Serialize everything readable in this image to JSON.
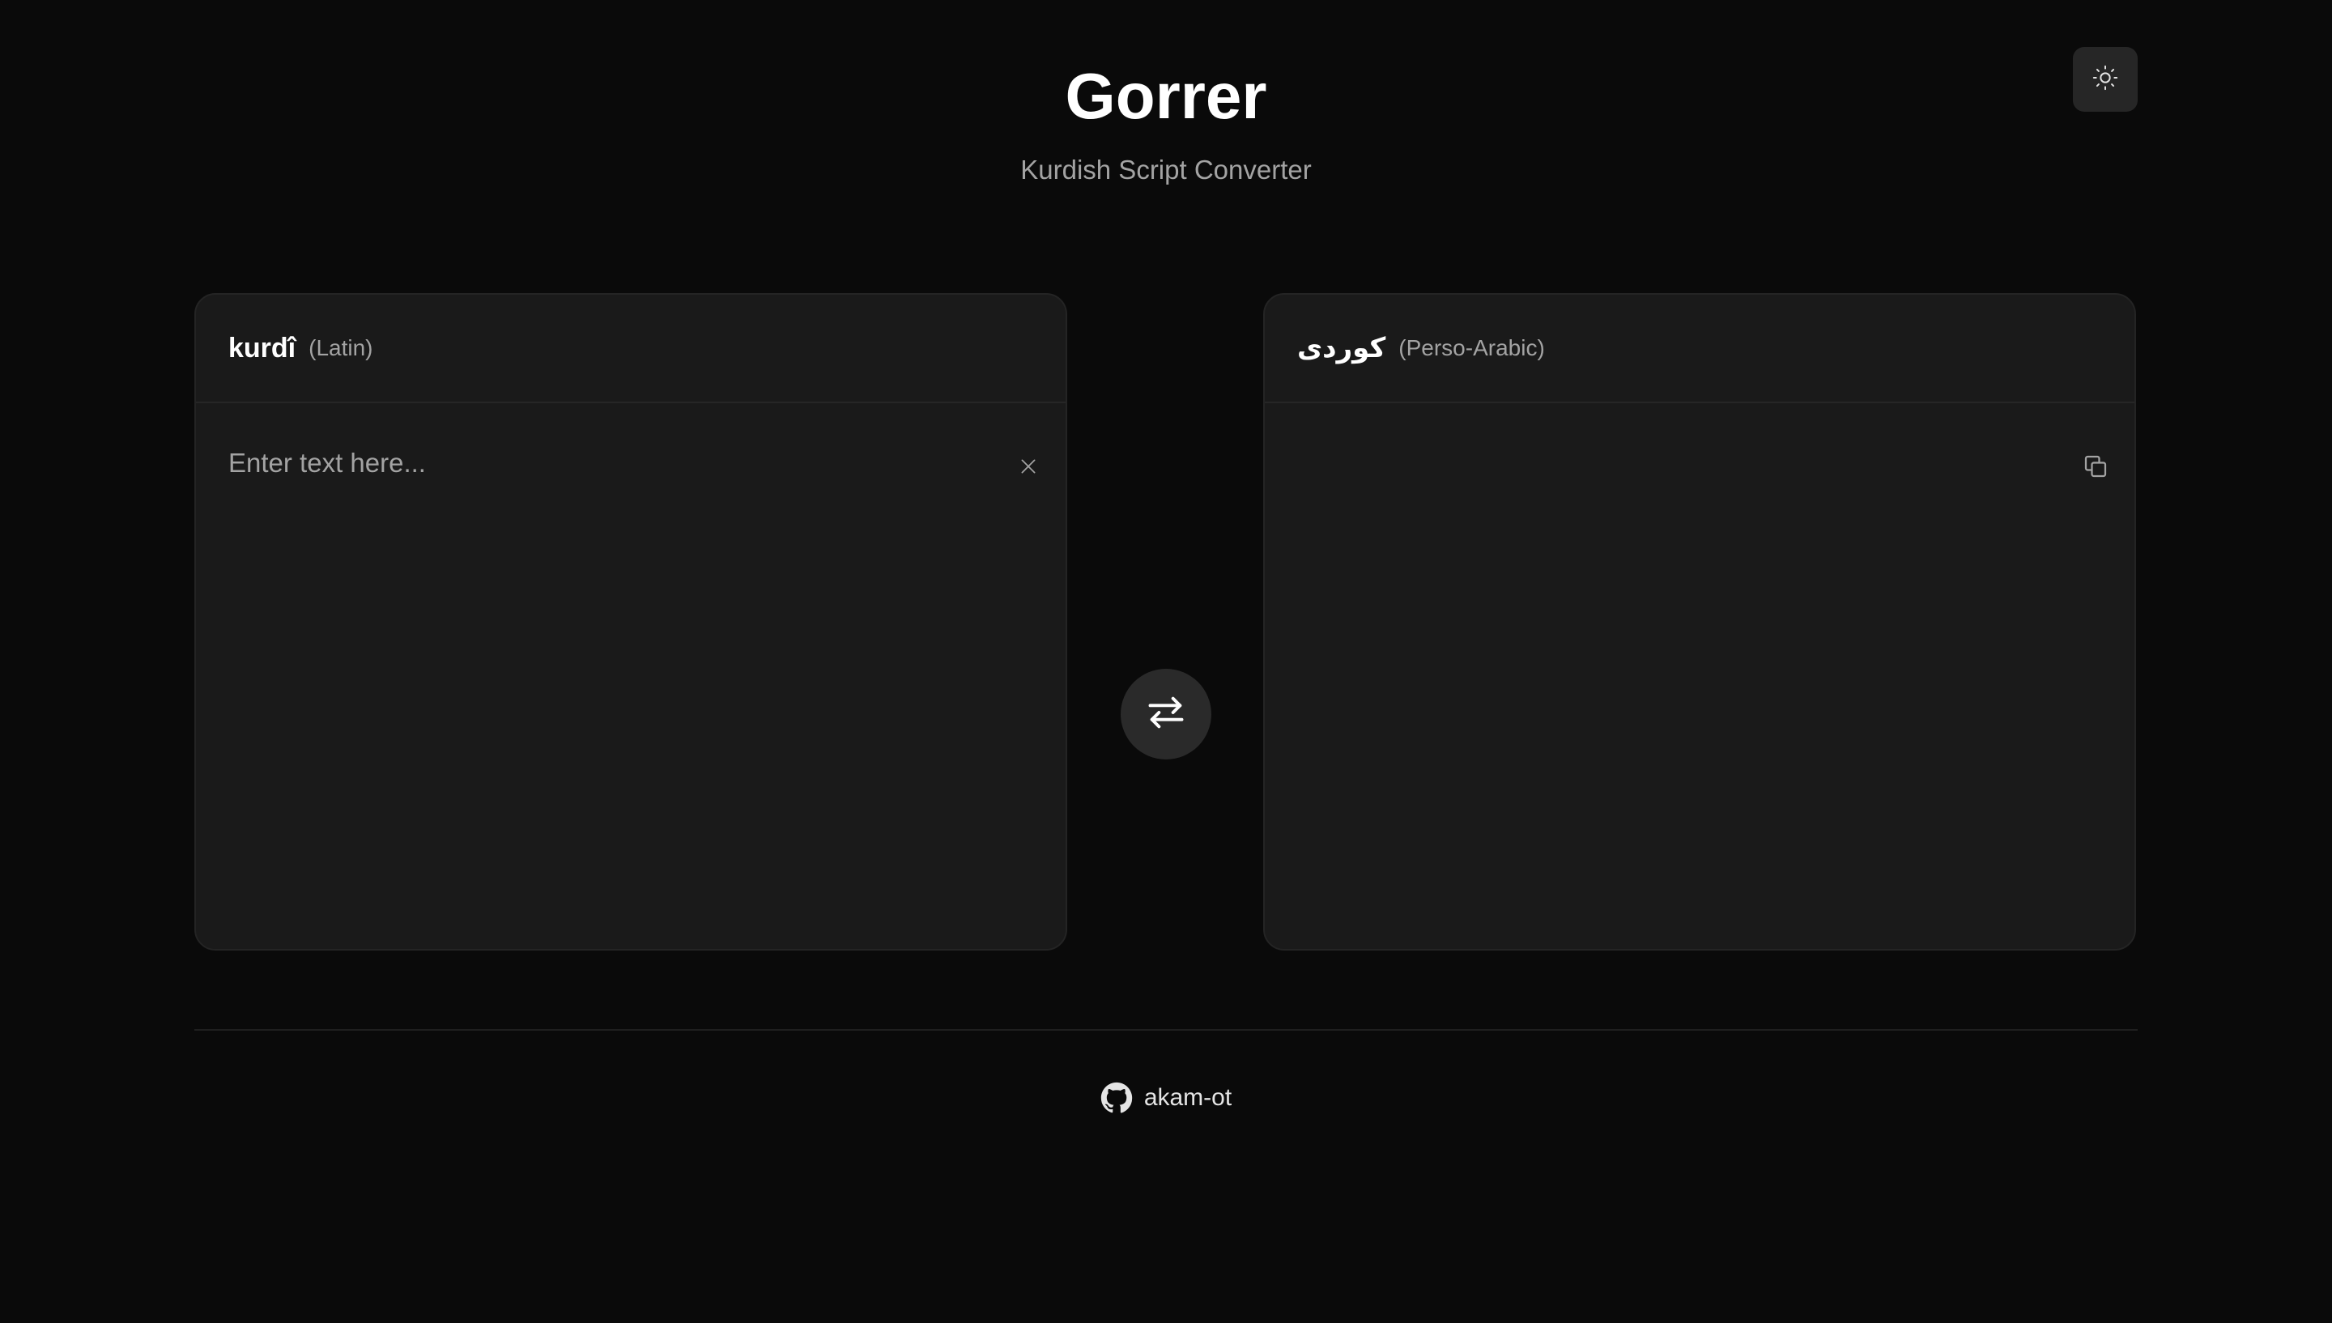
{
  "header": {
    "title": "Gorrer",
    "subtitle": "Kurdish Script Converter",
    "theme_toggle_icon": "sun-icon"
  },
  "source_panel": {
    "name": "kurdî",
    "script": "(Latin)",
    "input_value": "",
    "placeholder": "Enter text here...",
    "clear_icon": "close-icon"
  },
  "target_panel": {
    "name": "کوردی",
    "script": "(Perso-Arabic)",
    "output_value": "",
    "copy_icon": "copy-icon"
  },
  "swap_icon": "swap-arrows-icon",
  "footer": {
    "link_icon": "github-icon",
    "link_label": "akam-ot"
  },
  "colors": {
    "background": "#0a0a0a",
    "panel": "#1a1a1a",
    "text": "#ffffff",
    "muted": "#a3a3a3"
  }
}
